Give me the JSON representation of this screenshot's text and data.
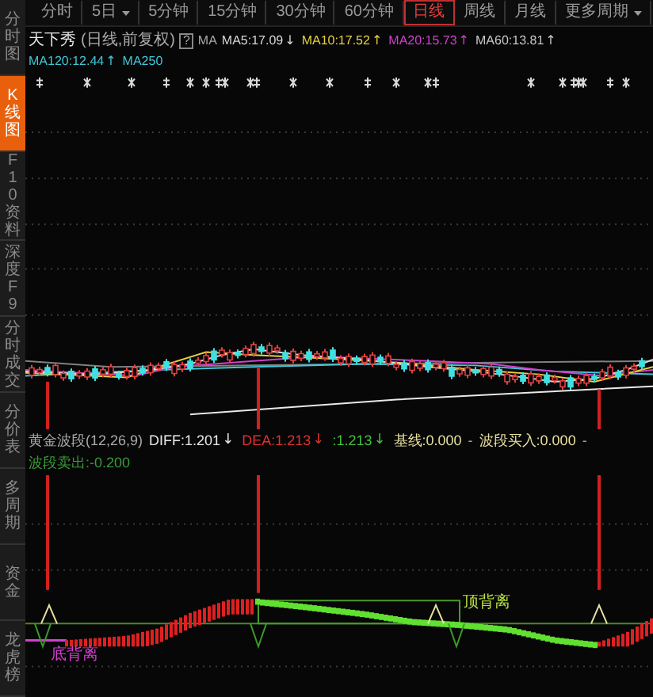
{
  "sidebar": {
    "items": [
      {
        "label": "分时图",
        "selected": false
      },
      {
        "label": "K线图",
        "selected": true
      },
      {
        "label": "F10资料",
        "selected": false
      },
      {
        "label": "深度F9",
        "selected": false
      },
      {
        "label": "分时成交",
        "selected": false
      },
      {
        "label": "分价表",
        "selected": false
      },
      {
        "label": "多周期",
        "selected": false
      },
      {
        "label": "资金",
        "selected": false
      },
      {
        "label": "龙虎榜",
        "selected": false
      }
    ]
  },
  "toolbar": {
    "buttons": [
      {
        "label": "分时",
        "selected": false,
        "dropdown": false
      },
      {
        "label": "5日",
        "selected": false,
        "dropdown": true
      },
      {
        "label": "5分钟",
        "selected": false,
        "dropdown": false
      },
      {
        "label": "15分钟",
        "selected": false,
        "dropdown": false
      },
      {
        "label": "30分钟",
        "selected": false,
        "dropdown": false
      },
      {
        "label": "60分钟",
        "selected": false,
        "dropdown": false
      },
      {
        "label": "日线",
        "selected": true,
        "dropdown": false
      },
      {
        "label": "周线",
        "selected": false,
        "dropdown": false
      },
      {
        "label": "月线",
        "selected": false,
        "dropdown": false
      },
      {
        "label": "更多周期",
        "selected": false,
        "dropdown": true
      }
    ]
  },
  "quote_header": {
    "name": "天下秀",
    "mode": "(日线,前复权)",
    "help": "?",
    "ma_label": "MA",
    "averages": [
      {
        "label": "MA5:17.09",
        "arrow": "↓",
        "color": "#d8d8d8"
      },
      {
        "label": "MA10:17.52",
        "arrow": "↑",
        "color": "#e8d040"
      },
      {
        "label": "MA20:15.73",
        "arrow": "↑",
        "color": "#d040d0"
      },
      {
        "label": "MA60:13.81",
        "arrow": "↑",
        "color": "#c8c8c8"
      },
      {
        "label": "MA120:12.44",
        "arrow": "↑",
        "color": "#40c8d8"
      },
      {
        "label": "MA250",
        "color": "#40c8d8"
      }
    ]
  },
  "indicator": {
    "title": "黄金波段(12,26,9)",
    "values": [
      {
        "label": "DIFF:1.201",
        "arrow": "↓",
        "color": "#e8e8e8"
      },
      {
        "label": "DEA:1.213",
        "arrow": "↓",
        "color": "#e03030"
      },
      {
        "label": ":1.213",
        "arrow": "↓",
        "color": "#40c040"
      },
      {
        "label": "基线:0.000",
        "color": "#e8e0a0"
      },
      {
        "label": "波段买入:0.000",
        "color": "#e8e0a0",
        "separator": "-"
      },
      {
        "label": "波段卖出:-0.200",
        "color": "#3a9a3a",
        "separator": "-"
      }
    ],
    "annotations": [
      {
        "label": "底背离",
        "kind": "bottom",
        "color": "#d040d0"
      },
      {
        "label": "顶背离",
        "kind": "top",
        "color": "#b8e040"
      }
    ]
  }
}
